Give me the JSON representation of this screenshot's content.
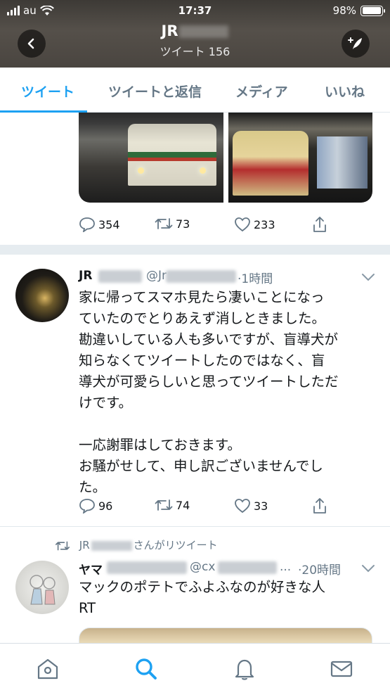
{
  "status_bar": {
    "carrier": "au",
    "time": "17:37",
    "battery": "98%",
    "battery_level": 0.98
  },
  "header": {
    "title": "JR",
    "subtitle": "ツイート 156"
  },
  "tabs": [
    {
      "label": "ツイート",
      "active": true
    },
    {
      "label": "ツイートと返信",
      "active": false
    },
    {
      "label": "メディア",
      "active": false
    },
    {
      "label": "いいね",
      "active": false
    }
  ],
  "tweet1": {
    "replies": "354",
    "retweets": "73",
    "likes": "233"
  },
  "tweet2": {
    "name": "JR",
    "handle": "@Jr",
    "time": "·1時間",
    "text": "家に帰ってスマホ見たら凄いことになっ\nていたのでとりあえず消しときました。\n勘違いしている人も多いですが、盲導犬が\n知らなくてツイートしたのではなく、盲\n導犬が可愛らしいと思ってツイートしただ\nけです。\n\n一応謝罪はしておきます。\nお騒がせして、申し訳ございませんでし\nた。",
    "replies": "96",
    "retweets": "74",
    "likes": "33"
  },
  "tweet3": {
    "retweeted_by": "JR",
    "retweet_suffix": "さんがリツイート",
    "name": "ヤマ",
    "handle": "@cx",
    "ellipsis": "...",
    "time": "·20時間",
    "text": "マックのポテトでふよふなのが好きな人\nRT"
  },
  "colors": {
    "accent": "#1da1f2",
    "muted": "#657786",
    "text": "#14171a"
  },
  "icons": [
    "back-arrow-icon",
    "compose-tweet-icon",
    "reply-icon",
    "retweet-icon",
    "like-icon",
    "share-icon",
    "chevron-down-icon",
    "home-icon",
    "search-icon",
    "notifications-icon",
    "messages-icon"
  ]
}
